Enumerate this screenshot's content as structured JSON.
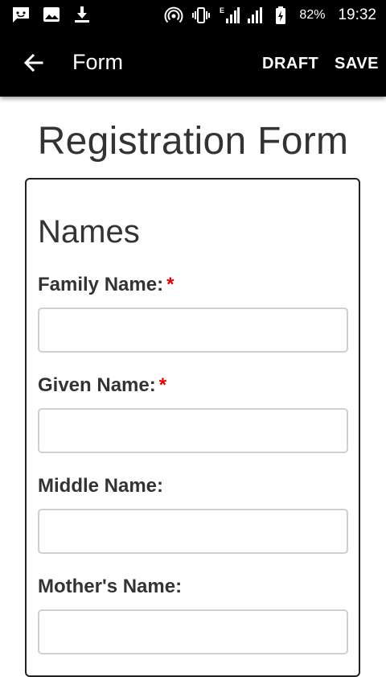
{
  "status_bar": {
    "battery": "82%",
    "time": "19:32",
    "icons": [
      "message-icon",
      "image-icon",
      "download-icon",
      "hotspot-icon",
      "vibrate-icon",
      "signal-e-icon",
      "signal-icon",
      "battery-icon"
    ]
  },
  "app_bar": {
    "title": "Form",
    "actions": {
      "draft": "DRAFT",
      "save": "SAVE"
    }
  },
  "form": {
    "title": "Registration Form",
    "section": "Names",
    "required_marker": "*",
    "fields": [
      {
        "label": "Family Name:",
        "required": true,
        "value": ""
      },
      {
        "label": "Given Name:",
        "required": true,
        "value": ""
      },
      {
        "label": "Middle Name:",
        "required": false,
        "value": ""
      },
      {
        "label": "Mother's Name:",
        "required": false,
        "value": ""
      }
    ]
  },
  "colors": {
    "bar_bg": "#000000",
    "required": "#e00000",
    "text": "#333333",
    "input_border": "#cfcfcf"
  }
}
